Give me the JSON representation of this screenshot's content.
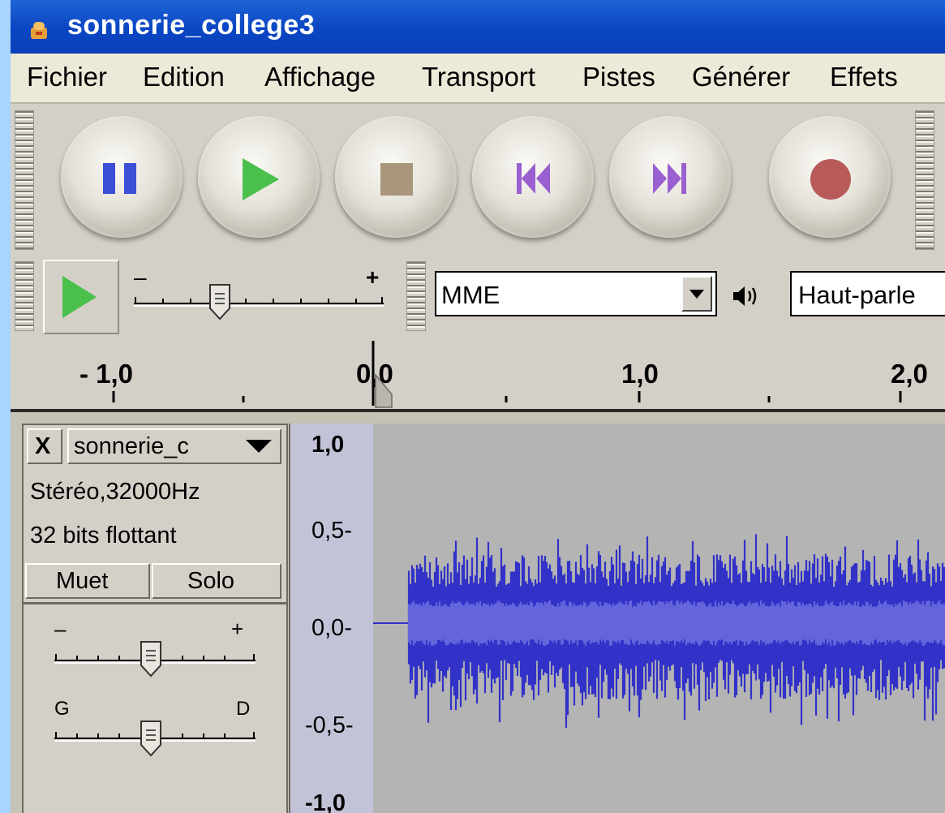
{
  "window": {
    "title": "sonnerie_college3"
  },
  "menu": [
    "Fichier",
    "Edition",
    "Affichage",
    "Transport",
    "Pistes",
    "Générer",
    "Effets"
  ],
  "transport": {
    "buttons": [
      {
        "name": "pause-button",
        "icon": "pause-icon"
      },
      {
        "name": "play-button",
        "icon": "play-icon"
      },
      {
        "name": "stop-button",
        "icon": "stop-icon"
      },
      {
        "name": "skip-start-button",
        "icon": "skip-start-icon"
      },
      {
        "name": "skip-end-button",
        "icon": "skip-end-icon"
      },
      {
        "name": "record-button",
        "icon": "record-icon"
      }
    ]
  },
  "device": {
    "speed_minus": "–",
    "speed_plus": "+",
    "host": "MME",
    "output": "Haut-parle"
  },
  "ruler": {
    "labels": [
      "- 1,0",
      "0,0",
      "1,0",
      "2,0"
    ]
  },
  "track": {
    "name": "sonnerie_c",
    "close_label": "X",
    "info_line1": "Stéréo,32000Hz",
    "info_line2": "32 bits flottant",
    "mute_label": "Muet",
    "solo_label": "Solo",
    "gain_minus": "–",
    "gain_plus": "+",
    "pan_left": "G",
    "pan_right": "D",
    "scale": [
      "1,0",
      "0,5-",
      "0,0-",
      "-0,5-",
      "-1,0"
    ]
  },
  "colors": {
    "waveform_outer": "#3232c8",
    "waveform_inner": "#6464dc",
    "waveform_bg": "#b4b4b4",
    "title_bar": "#0a46c3"
  }
}
